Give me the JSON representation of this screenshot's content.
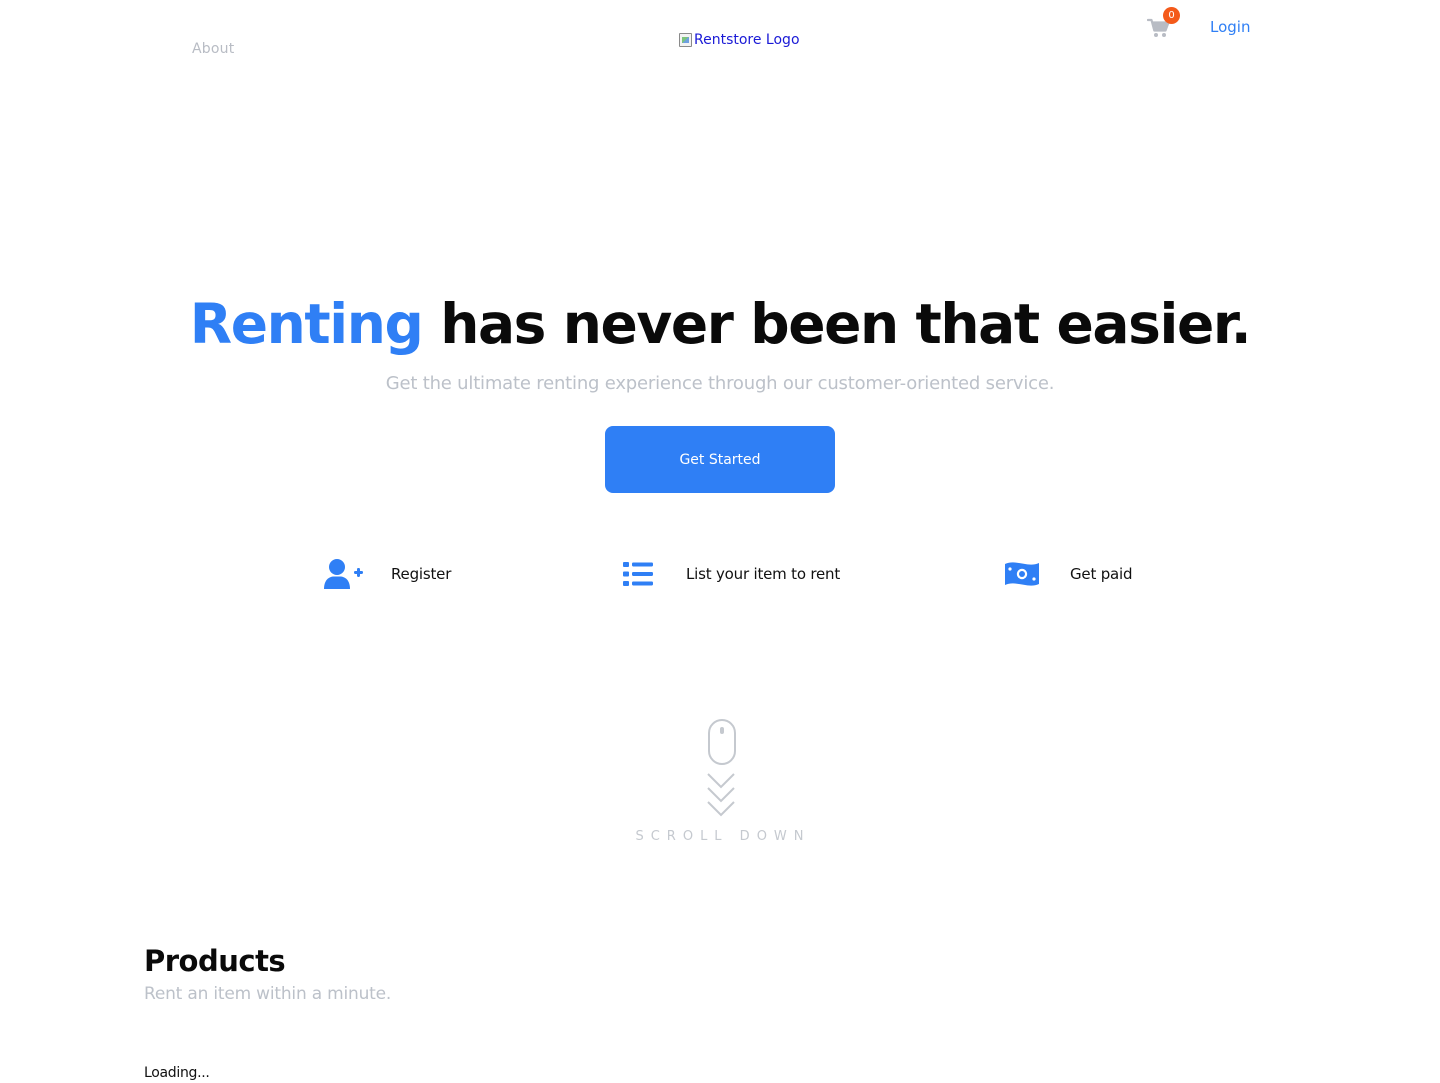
{
  "header": {
    "nav": {
      "about": "About"
    },
    "logo_alt": "Rentstore Logo",
    "cart": {
      "icon": "cart-icon",
      "count": "0"
    },
    "login": "Login"
  },
  "hero": {
    "title_accent": "Renting",
    "title_rest": " has never been that easier.",
    "subtitle": "Get the ultimate renting experience through our customer-oriented service.",
    "cta": "Get Started"
  },
  "steps": [
    {
      "icon": "user-plus-icon",
      "label": "Register"
    },
    {
      "icon": "list-icon",
      "label": "List your item to rent"
    },
    {
      "icon": "money-bill-icon",
      "label": "Get paid"
    }
  ],
  "scroll": {
    "label": "SCROLL DOWN"
  },
  "products": {
    "title": "Products",
    "subtitle": "Rent an item within a minute.",
    "status": "Loading..."
  },
  "colors": {
    "accent": "#2f7ff5",
    "badge": "#f45a1a",
    "muted": "#bcc1c9"
  }
}
